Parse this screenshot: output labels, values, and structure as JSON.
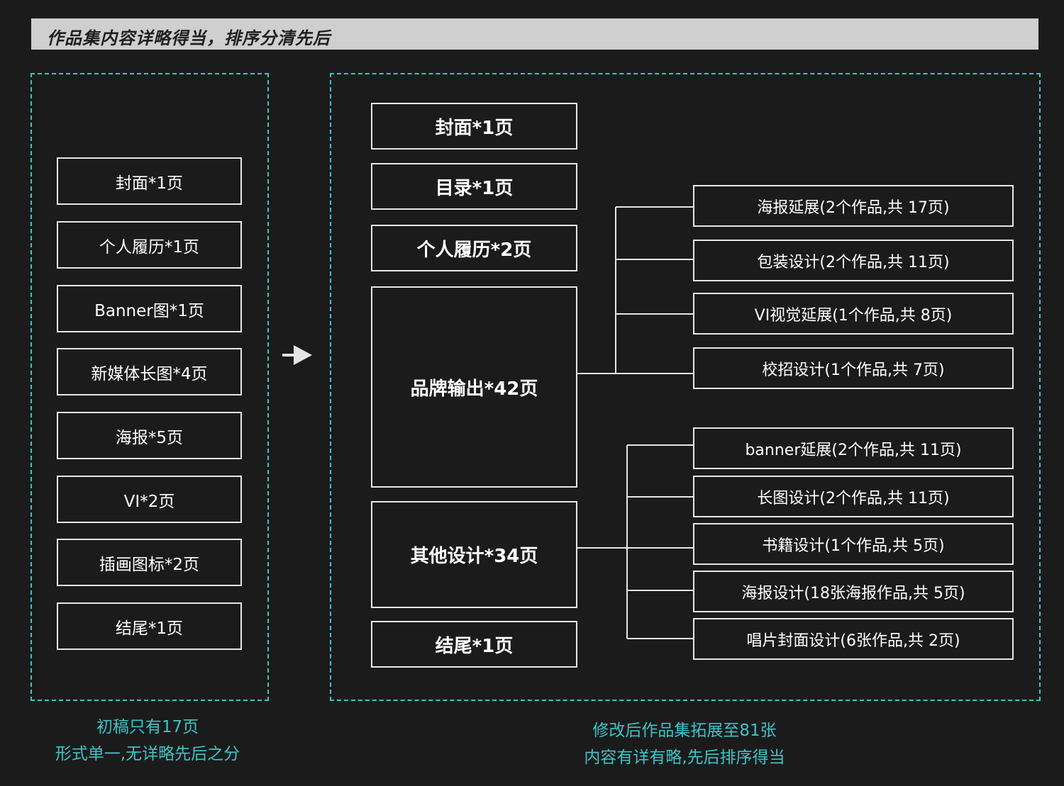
{
  "header": {
    "title": "作品集内容详略得当，排序分清先后"
  },
  "before": {
    "items": [
      "封面*1页",
      "个人履历*1页",
      "Banner图*1页",
      "新媒体长图*4页",
      "海报*5页",
      "VI*2页",
      "插画图标*2页",
      "结尾*1页"
    ],
    "caption_line1": "初稿只有17页",
    "caption_line2": "形式单一,无详略先后之分"
  },
  "after": {
    "items": [
      "封面*1页",
      "目录*1页",
      "个人履历*2页",
      "品牌输出*42页",
      "其他设计*34页",
      "结尾*1页"
    ],
    "brand_children": [
      "海报延展(2个作品,共 17页)",
      "包装设计(2个作品,共 11页)",
      "VI视觉延展(1个作品,共 8页)",
      "校招设计(1个作品,共 7页)"
    ],
    "other_children": [
      "banner延展(2个作品,共 11页)",
      "长图设计(2个作品,共 11页)",
      "书籍设计(1个作品,共 5页)",
      "海报设计(18张海报作品,共 5页)",
      "唱片封面设计(6张作品,共 2页)"
    ],
    "caption_line1": "修改后作品集拓展至81张",
    "caption_line2": "内容有详有略,先后排序得当"
  },
  "colors": {
    "accent": "#3cc4c8",
    "background": "#1b1b1b",
    "header_bar": "#cfcfcf",
    "border": "#e6e6e6"
  },
  "icons": {
    "transition": "right-arrow-icon"
  }
}
